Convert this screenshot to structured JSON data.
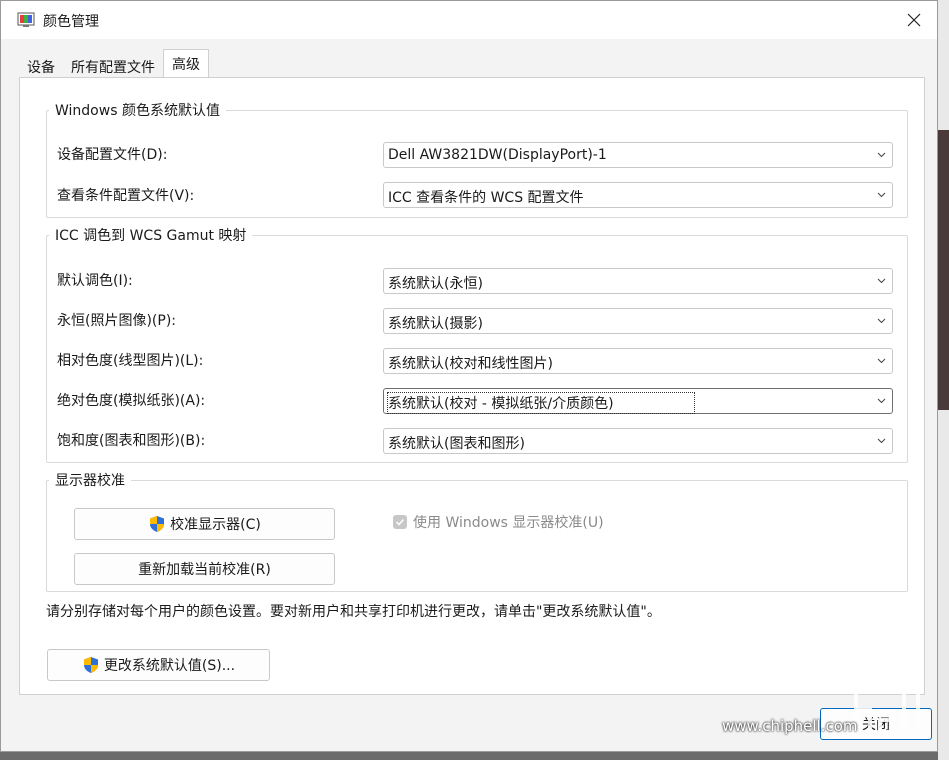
{
  "window": {
    "title": "颜色管理"
  },
  "tabs": [
    {
      "label": "设备",
      "active": false
    },
    {
      "label": "所有配置文件",
      "active": false
    },
    {
      "label": "高级",
      "active": true
    }
  ],
  "defaults_group": {
    "legend": "Windows 颜色系统默认值",
    "rows": [
      {
        "label": "设备配置文件(D):",
        "value": "Dell AW3821DW(DisplayPort)-1"
      },
      {
        "label": "查看条件配置文件(V):",
        "value": "ICC 查看条件的 WCS 配置文件"
      }
    ]
  },
  "gamut_group": {
    "legend": "ICC 调色到 WCS Gamut 映射",
    "rows": [
      {
        "label": "默认调色(I):",
        "value": "系统默认(永恒)"
      },
      {
        "label": "永恒(照片图像)(P):",
        "value": "系统默认(摄影)"
      },
      {
        "label": "相对色度(线型图片)(L):",
        "value": "系统默认(校对和线性图片)"
      },
      {
        "label": "绝对色度(模拟纸张)(A):",
        "value": "系统默认(校对 - 模拟纸张/介质颜色)"
      },
      {
        "label": "饱和度(图表和图形)(B):",
        "value": "系统默认(图表和图形)"
      }
    ]
  },
  "calibration_group": {
    "legend": "显示器校准",
    "calibrate_button": "校准显示器(C)",
    "reload_button": "重新加载当前校准(R)",
    "use_windows_calibration": {
      "label": "使用 Windows 显示器校准(U)",
      "checked": true,
      "enabled": false
    }
  },
  "note": "请分别存储对每个用户的颜色设置。要对新用户和共享打印机进行更改，请单击\"更改系统默认值\"。",
  "change_defaults_button": "更改系统默认值(S)...",
  "close_button": "关闭",
  "watermark": {
    "url": "www.chiphell.com"
  },
  "colors": {
    "accent": "#0067c0",
    "panel": "#ffffff",
    "dialog": "#f3f3f3"
  }
}
